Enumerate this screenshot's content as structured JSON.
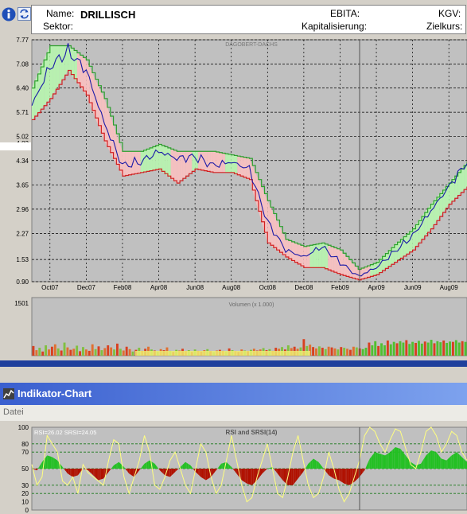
{
  "header": {
    "name_label": "Name:",
    "name_value": "DRILLISCH",
    "sector_label": "Sektor:",
    "ebita_label": "EBITA:",
    "cap_label": "Kapitalisierung:",
    "kgv_label": "KGV:",
    "target_label": "Zielkurs:"
  },
  "colors": {
    "plot_bg": "#c0c0c0",
    "price_line": "#1a1aa8",
    "band_upper": "#2d9e2d",
    "band_lower": "#d02020",
    "band_fill_up": "#b8f0b0",
    "band_fill_down": "#f4c0c0",
    "rsi_up": "#22c022",
    "rsi_down": "#b01000",
    "srsi_line": "#ffff80",
    "titlebar": "#3a5fcf"
  },
  "window": {
    "title": "Indikator-Chart",
    "menu_file": "Datei"
  },
  "chart_data": [
    {
      "type": "line",
      "title": "DAGOBERT-DACHS",
      "current_price": 4.83,
      "y_ticks": [
        7.77,
        7.08,
        6.4,
        5.71,
        5.02,
        4.83,
        4.34,
        3.65,
        2.96,
        2.27,
        1.53,
        0.9
      ],
      "ylim": [
        0.9,
        7.77
      ],
      "x_ticks": [
        "Oct07",
        "Dec07",
        "Feb08",
        "Apr08",
        "Jun08",
        "Aug08",
        "Oct08",
        "Dec08",
        "Feb09",
        "Apr09",
        "Jun09",
        "Aug09"
      ],
      "x_months": [
        "2007-09",
        "2007-10",
        "2007-11",
        "2007-12",
        "2008-01",
        "2008-02",
        "2008-03",
        "2008-04",
        "2008-05",
        "2008-06",
        "2008-07",
        "2008-08",
        "2008-09",
        "2008-10",
        "2008-11",
        "2008-12",
        "2009-01",
        "2009-02",
        "2009-03",
        "2009-04",
        "2009-05",
        "2009-06",
        "2009-07",
        "2009-08",
        "2009-09"
      ],
      "series": [
        {
          "values": [
            5.9,
            7.0,
            7.45,
            6.9,
            5.4,
            4.2,
            4.3,
            4.6,
            4.4,
            4.45,
            4.2,
            4.3,
            4.1,
            2.6,
            1.8,
            1.6,
            1.9,
            1.45,
            1.05,
            1.3,
            1.75,
            2.2,
            2.9,
            3.6,
            4.3
          ]
        },
        {
          "values": [
            6.4,
            7.6,
            7.6,
            7.2,
            6.1,
            4.6,
            4.6,
            4.8,
            4.6,
            4.6,
            4.6,
            4.5,
            4.4,
            3.2,
            2.1,
            1.9,
            2.0,
            1.8,
            1.25,
            1.45,
            1.95,
            2.4,
            3.1,
            3.7,
            4.3
          ]
        },
        {
          "values": [
            5.5,
            6.1,
            6.9,
            6.2,
            4.9,
            3.9,
            4.0,
            4.1,
            3.7,
            4.1,
            4.0,
            4.0,
            3.8,
            2.0,
            1.6,
            1.3,
            1.3,
            1.1,
            0.95,
            1.1,
            1.45,
            1.8,
            2.4,
            3.1,
            3.6
          ]
        }
      ]
    },
    {
      "type": "bar",
      "title": "Volumen (x 1.000)",
      "y_ticks": [
        1501
      ],
      "ylim": [
        0,
        1501
      ],
      "values": [
        280,
        160,
        230,
        120,
        300,
        180,
        260,
        330,
        210,
        150,
        380,
        240,
        170,
        200,
        290,
        130,
        250,
        180,
        140,
        330,
        190,
        270,
        160,
        220,
        300,
        240,
        180,
        350,
        200,
        150,
        260,
        190,
        120,
        170,
        230,
        140,
        200,
        260,
        180,
        150,
        120,
        190,
        160,
        240,
        140,
        110,
        170,
        150,
        200,
        130,
        160,
        110,
        180,
        140,
        120,
        160,
        190,
        130,
        100,
        150,
        170,
        140,
        120,
        210,
        160,
        130,
        110,
        180,
        150,
        130,
        170,
        200,
        150,
        180,
        220,
        160,
        190,
        140,
        230,
        200,
        250,
        180,
        300,
        220,
        260,
        200,
        240,
        480,
        280,
        320,
        250,
        210,
        270,
        230,
        190,
        260,
        240,
        210,
        180,
        250,
        230,
        200,
        170,
        260,
        240,
        210,
        190,
        230,
        380,
        300,
        420,
        280,
        360,
        300,
        440,
        330,
        400,
        360,
        420,
        380,
        450,
        340,
        400,
        370,
        430,
        350,
        410,
        380,
        460,
        360,
        420,
        390,
        440,
        370,
        410,
        400,
        450,
        380,
        420,
        400
      ]
    },
    {
      "type": "area",
      "title": "RSI and SRSI(14)",
      "annotation": "RSI=26.02 SRSI=24.05",
      "y_ticks": [
        100,
        80,
        70,
        50,
        30,
        20,
        10,
        0
      ],
      "ylim": [
        0,
        100
      ],
      "series": [
        {
          "values": [
            50,
            48,
            58,
            66,
            64,
            60,
            52,
            44,
            40,
            42,
            50,
            48,
            42,
            36,
            38,
            46,
            54,
            58,
            52,
            44,
            40,
            48,
            56,
            60,
            56,
            48,
            42,
            40,
            46,
            52,
            58,
            54,
            46,
            40,
            36,
            40,
            48,
            56,
            58,
            52,
            44,
            36,
            32,
            30,
            36,
            44,
            50,
            52,
            44,
            36,
            30,
            30,
            38,
            46,
            56,
            62,
            58,
            50,
            42,
            38,
            36,
            32,
            30,
            34,
            40,
            48,
            62,
            70,
            68,
            66,
            70,
            76,
            74,
            66,
            58,
            54,
            56,
            66,
            72,
            70,
            62,
            60,
            66,
            70,
            64,
            58
          ]
        },
        {
          "values": [
            55,
            30,
            40,
            90,
            80,
            70,
            35,
            30,
            40,
            20,
            55,
            45,
            40,
            35,
            30,
            60,
            85,
            80,
            40,
            20,
            40,
            60,
            90,
            70,
            30,
            25,
            40,
            60,
            70,
            50,
            30,
            20,
            50,
            80,
            70,
            40,
            20,
            30,
            60,
            90,
            60,
            30,
            10,
            15,
            40,
            60,
            80,
            50,
            20,
            15,
            40,
            70,
            90,
            60,
            30,
            15,
            20,
            40,
            70,
            50,
            25,
            10,
            20,
            40,
            60,
            90,
            100,
            95,
            80,
            70,
            85,
            98,
            95,
            75,
            55,
            50,
            70,
            95,
            100,
            90,
            70,
            80,
            95,
            90,
            70,
            60
          ]
        }
      ]
    }
  ]
}
